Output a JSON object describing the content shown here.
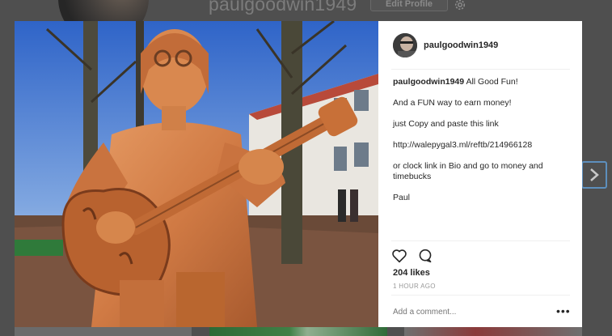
{
  "background": {
    "username": "paulgoodwin1949",
    "edit_profile_label": "Edit Profile",
    "settings_icon": "gear-icon",
    "next_icon": "chevron-right-icon"
  },
  "post": {
    "username": "paulgoodwin1949",
    "caption_first": "All Good Fun!",
    "caption_lines": [
      "And a FUN way to earn money!",
      "just Copy and paste this link",
      "http://walepygal3.ml/reftb/214966128",
      "or clock link in Bio and go to money and timebucks",
      "Paul"
    ],
    "likes": "204 likes",
    "time": "1 HOUR AGO",
    "comment_placeholder": "Add a comment...",
    "more_label": "•••",
    "icons": {
      "like": "heart-icon",
      "comment": "comment-bubble-icon",
      "more": "more-options-icon"
    }
  }
}
